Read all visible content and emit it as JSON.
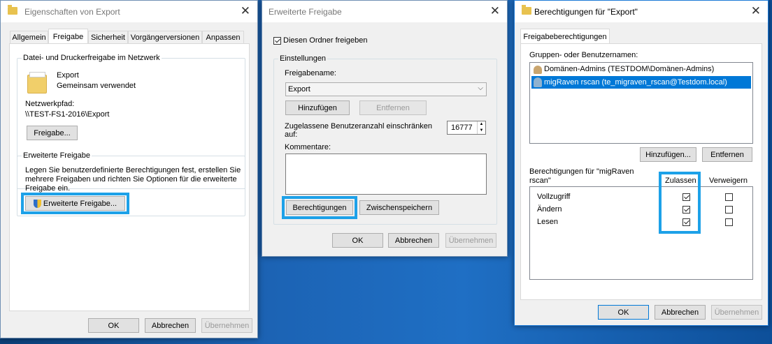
{
  "dialog1": {
    "title": "Eigenschaften von Export",
    "tabs": [
      "Allgemein",
      "Freigabe",
      "Sicherheit",
      "Vorgängerversionen",
      "Anpassen"
    ],
    "net_group_label": "Datei- und Druckerfreigabe im Netzwerk",
    "folder_name": "Export",
    "folder_state": "Gemeinsam verwendet",
    "path_label": "Netzwerkpfad:",
    "path_value": "\\\\TEST-FS1-2016\\Export",
    "share_button": "Freigabe...",
    "adv_group_label": "Erweiterte Freigabe",
    "adv_text_1": "Legen Sie benutzerdefinierte Berechtigungen fest, erstellen Sie",
    "adv_text_2": "mehrere Freigaben und richten Sie Optionen für die erweiterte",
    "adv_text_3": "Freigabe ein.",
    "adv_button": "Erweiterte Freigabe...",
    "ok": "OK",
    "cancel": "Abbrechen",
    "apply": "Übernehmen"
  },
  "dialog2": {
    "title": "Erweiterte Freigabe",
    "share_checkbox": "Diesen Ordner freigeben",
    "settings_label": "Einstellungen",
    "share_name_label": "Freigabename:",
    "share_name_value": "Export",
    "add": "Hinzufügen",
    "remove": "Entfernen",
    "limit_label_1": "Zugelassene Benutzeranzahl einschränken",
    "limit_label_2": "auf:",
    "limit_value": "16777",
    "comments_label": "Kommentare:",
    "permissions": "Berechtigungen",
    "caching": "Zwischenspeichern",
    "ok": "OK",
    "cancel": "Abbrechen",
    "apply": "Übernehmen"
  },
  "dialog3": {
    "title": "Berechtigungen für \"Export\"",
    "tab": "Freigabeberechtigungen",
    "users_label": "Gruppen- oder Benutzernamen:",
    "users": [
      "Domänen-Admins (TESTDOM\\Domänen-Admins)",
      "migRaven rscan (te_migraven_rscan@Testdom.local)"
    ],
    "add": "Hinzufügen...",
    "remove": "Entfernen",
    "perm_label_1": "Berechtigungen für \"migRaven",
    "perm_label_2": "rscan\"",
    "allow": "Zulassen",
    "deny": "Verweigern",
    "permissions": [
      "Vollzugriff",
      "Ändern",
      "Lesen"
    ],
    "ok": "OK",
    "cancel": "Abbrechen",
    "apply": "Übernehmen"
  }
}
